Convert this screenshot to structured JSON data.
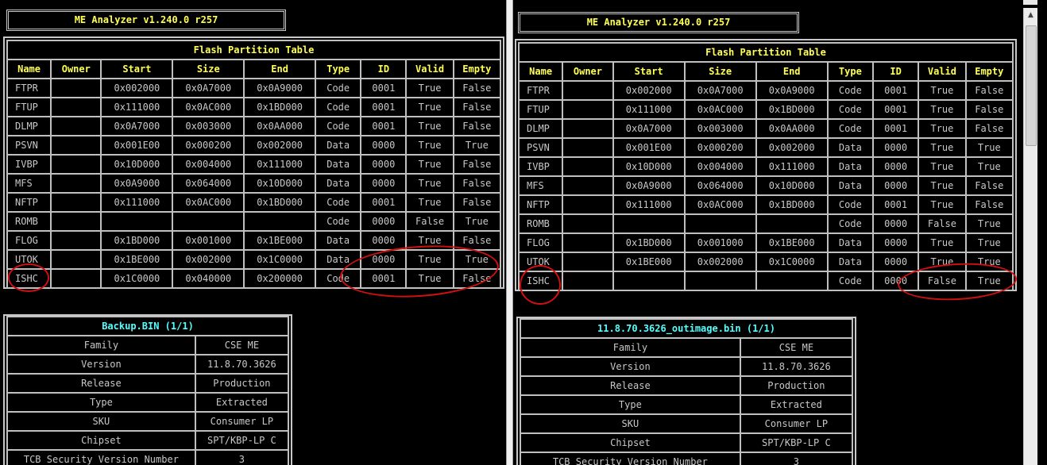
{
  "app_title": "ME Analyzer v1.240.0 r257",
  "table_title": "Flash Partition Table",
  "headers": [
    "Name",
    "Owner",
    "Start",
    "Size",
    "End",
    "Type",
    "ID",
    "Valid",
    "Empty"
  ],
  "left": {
    "rows": [
      [
        "FTPR",
        "",
        "0x002000",
        "0x0A7000",
        "0x0A9000",
        "Code",
        "0001",
        "True",
        "False"
      ],
      [
        "FTUP",
        "",
        "0x111000",
        "0x0AC000",
        "0x1BD000",
        "Code",
        "0001",
        "True",
        "False"
      ],
      [
        "DLMP",
        "",
        "0x0A7000",
        "0x003000",
        "0x0AA000",
        "Code",
        "0001",
        "True",
        "False"
      ],
      [
        "PSVN",
        "",
        "0x001E00",
        "0x000200",
        "0x002000",
        "Data",
        "0000",
        "True",
        "True"
      ],
      [
        "IVBP",
        "",
        "0x10D000",
        "0x004000",
        "0x111000",
        "Data",
        "0000",
        "True",
        "False"
      ],
      [
        "MFS",
        "",
        "0x0A9000",
        "0x064000",
        "0x10D000",
        "Data",
        "0000",
        "True",
        "False"
      ],
      [
        "NFTP",
        "",
        "0x111000",
        "0x0AC000",
        "0x1BD000",
        "Code",
        "0001",
        "True",
        "False"
      ],
      [
        "ROMB",
        "",
        "",
        "",
        "",
        "Code",
        "0000",
        "False",
        "True"
      ],
      [
        "FLOG",
        "",
        "0x1BD000",
        "0x001000",
        "0x1BE000",
        "Data",
        "0000",
        "True",
        "False"
      ],
      [
        "UTOK",
        "",
        "0x1BE000",
        "0x002000",
        "0x1C0000",
        "Data",
        "0000",
        "True",
        "True"
      ],
      [
        "ISHC",
        "",
        "0x1C0000",
        "0x040000",
        "0x200000",
        "Code",
        "0001",
        "True",
        "False"
      ]
    ],
    "info_title": "Backup.BIN (1/1)",
    "info": [
      [
        "Family",
        "CSE ME"
      ],
      [
        "Version",
        "11.8.70.3626"
      ],
      [
        "Release",
        "Production"
      ],
      [
        "Type",
        "Extracted"
      ],
      [
        "SKU",
        "Consumer LP"
      ],
      [
        "Chipset",
        "SPT/KBP-LP C"
      ],
      [
        "TCB Security Version Number",
        "3"
      ]
    ]
  },
  "right": {
    "rows": [
      [
        "FTPR",
        "",
        "0x002000",
        "0x0A7000",
        "0x0A9000",
        "Code",
        "0001",
        "True",
        "False"
      ],
      [
        "FTUP",
        "",
        "0x111000",
        "0x0AC000",
        "0x1BD000",
        "Code",
        "0001",
        "True",
        "False"
      ],
      [
        "DLMP",
        "",
        "0x0A7000",
        "0x003000",
        "0x0AA000",
        "Code",
        "0001",
        "True",
        "False"
      ],
      [
        "PSVN",
        "",
        "0x001E00",
        "0x000200",
        "0x002000",
        "Data",
        "0000",
        "True",
        "True"
      ],
      [
        "IVBP",
        "",
        "0x10D000",
        "0x004000",
        "0x111000",
        "Data",
        "0000",
        "True",
        "True"
      ],
      [
        "MFS",
        "",
        "0x0A9000",
        "0x064000",
        "0x10D000",
        "Data",
        "0000",
        "True",
        "False"
      ],
      [
        "NFTP",
        "",
        "0x111000",
        "0x0AC000",
        "0x1BD000",
        "Code",
        "0001",
        "True",
        "False"
      ],
      [
        "ROMB",
        "",
        "",
        "",
        "",
        "Code",
        "0000",
        "False",
        "True"
      ],
      [
        "FLOG",
        "",
        "0x1BD000",
        "0x001000",
        "0x1BE000",
        "Data",
        "0000",
        "True",
        "True"
      ],
      [
        "UTOK",
        "",
        "0x1BE000",
        "0x002000",
        "0x1C0000",
        "Data",
        "0000",
        "True",
        "True"
      ],
      [
        "ISHC",
        "",
        "",
        "",
        "",
        "Code",
        "0000",
        "False",
        "True"
      ]
    ],
    "info_title": "11.8.70.3626_outimage.bin (1/1)",
    "info": [
      [
        "Family",
        "CSE ME"
      ],
      [
        "Version",
        "11.8.70.3626"
      ],
      [
        "Release",
        "Production"
      ],
      [
        "Type",
        "Extracted"
      ],
      [
        "SKU",
        "Consumer LP"
      ],
      [
        "Chipset",
        "SPT/KBP-LP C"
      ],
      [
        "TCB Security Version Number",
        "3"
      ]
    ]
  },
  "colors": {
    "background": "#000000",
    "text": "#c8c8c8",
    "header": "#ffff55",
    "info_title": "#55ffff",
    "annotation": "#d01010"
  }
}
